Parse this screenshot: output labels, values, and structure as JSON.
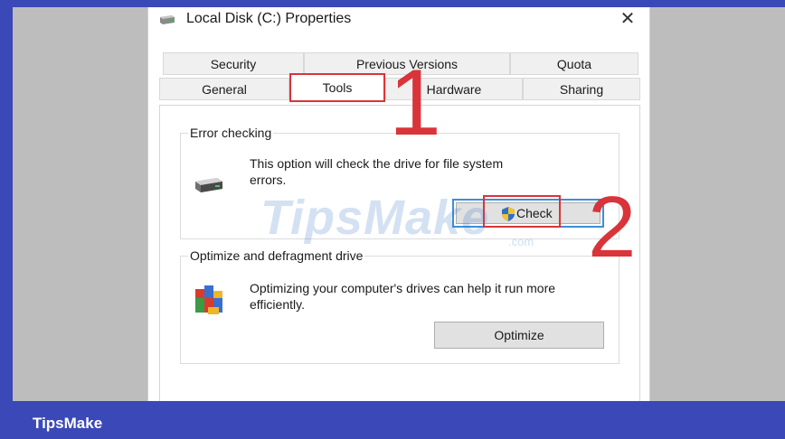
{
  "frame": {
    "brand": "TipsMake"
  },
  "dialog": {
    "title": "Local Disk (C:) Properties",
    "title_icon": "drive-icon",
    "close_glyph": "✕"
  },
  "tabs": {
    "row1": [
      "Security",
      "Previous Versions",
      "Quota"
    ],
    "row2": [
      "General",
      "Tools",
      "Hardware",
      "Sharing"
    ],
    "active": "Tools"
  },
  "error_checking": {
    "label": "Error checking",
    "description_line1": "This option will check the drive for file system",
    "description_line2": "errors.",
    "icon": "drive-icon",
    "button": "Check",
    "button_icon": "uac-shield-icon"
  },
  "optimize": {
    "label": "Optimize and defragment drive",
    "description_line1": "Optimizing your computer's drives can help it run more",
    "description_line2": "efficiently.",
    "icon": "defrag-icon",
    "button": "Optimize"
  },
  "annotations": {
    "step1": "1",
    "step2": "2"
  },
  "watermark": {
    "main": "TipsMake",
    "sub": ".com"
  },
  "colors": {
    "frame": "#3b48b8",
    "highlight": "#d9343a",
    "focus": "#3c8fd6"
  }
}
